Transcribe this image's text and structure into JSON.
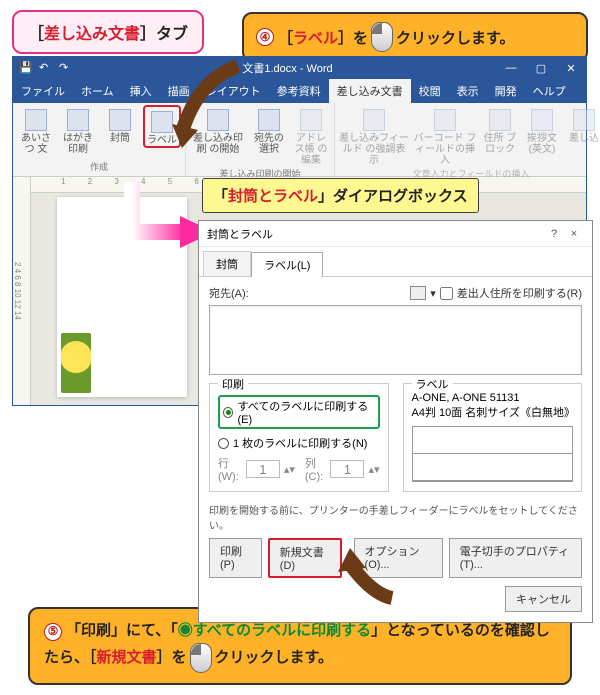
{
  "callouts": {
    "c1_pre": "［",
    "c1_red": "差し込み文書",
    "c1_post": "］タブ",
    "c2_num": "④",
    "c2_pre": "［",
    "c2_red": "ラベル",
    "c2_post": "］を",
    "c2_end": "クリックします。",
    "c3_pre": "「",
    "c3_red": "封筒とラベル",
    "c3_post": "」ダイアログボックス",
    "c4_num": "⑤",
    "c4_t1": "「印刷」にて、「",
    "c4_green": "◉すべてのラベルに印刷する",
    "c4_t2": "」となっているのを確認したら、［",
    "c4_red": "新規文書",
    "c4_t3": "］を",
    "c4_end": "クリックします。"
  },
  "word": {
    "title": "文書1.docx - Word",
    "tabs": {
      "file": "ファイル",
      "home": "ホーム",
      "insert": "挿入",
      "draw": "描画",
      "layout": "レイアウト",
      "ref": "参考資料",
      "mailing": "差し込み文書",
      "review": "校閲",
      "view": "表示",
      "dev": "開発",
      "help": "ヘルプ"
    },
    "ribbon": {
      "g1": {
        "name": "作成",
        "items": {
          "aisatsu": "あいさつ\n文",
          "hagaki": "はがき\n印刷",
          "envelope": "封筒",
          "label": "ラベル"
        }
      },
      "g2": {
        "name": "差し込み印刷の開始",
        "items": {
          "start": "差し込み印刷\nの開始",
          "recipient": "宛先の\n選択",
          "edit": "アドレス帳\nの編集"
        }
      },
      "g3": {
        "name": "文章入力とフィールドの挿入",
        "items": {
          "highlight": "差し込みフィールド\nの強調表示",
          "barcode": "バーコード\nフィールドの挿入",
          "block": "住所\nブロック",
          "greet": "挨拶文\n(英文)",
          "insert": "差し込"
        }
      }
    },
    "ruler_h": "1 2 3 4 5 6 7 8",
    "ruler_v": "2 4 6 8 10 12 14"
  },
  "dialog": {
    "title": "封筒とラベル",
    "help": "?",
    "close": "×",
    "tab_env": "封筒",
    "tab_label": "ラベル(L)",
    "addr_label": "宛先(A):",
    "sender_cb": "差出人住所を印刷する(R)",
    "print_legend": "印刷",
    "radio_all": "すべてのラベルに印刷する(E)",
    "radio_one": "1 枚のラベルに印刷する(N)",
    "row_lbl": "行(W):",
    "row_val": "1",
    "col_lbl": "列(C):",
    "col_val": "1",
    "label_legend": "ラベル",
    "label_prod": "A-ONE, A-ONE 51131",
    "label_desc": "A4判 10面 名刺サイズ《白無地》",
    "note": "印刷を開始する前に、プリンターの手差しフィーダーにラベルをセットしてください。",
    "btn_print": "印刷(P)",
    "btn_newdoc": "新規文書(D)",
    "btn_option": "オプション(O)...",
    "btn_prop": "電子切手のプロパティ(T)...",
    "btn_cancel": "キャンセル"
  }
}
